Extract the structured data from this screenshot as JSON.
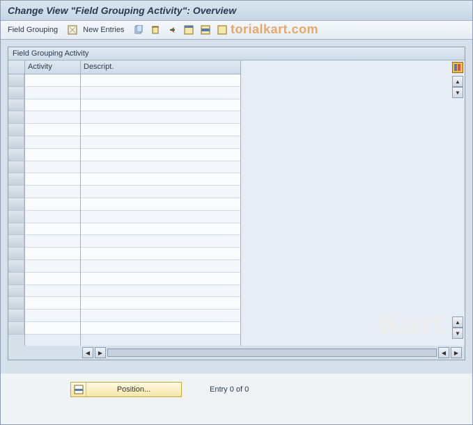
{
  "title": "Change View \"Field Grouping Activity\": Overview",
  "toolbar": {
    "field_grouping_label": "Field Grouping",
    "new_entries_label": "New Entries",
    "icons": {
      "details": "details-icon",
      "copy": "copy-icon",
      "delete": "delete-icon",
      "undo": "undo-icon",
      "select_all": "select-all-icon",
      "select_block": "select-block-icon",
      "deselect_all": "deselect-all-icon"
    }
  },
  "watermark": "torialkart.com",
  "big_watermark": "Kart",
  "panel": {
    "header": "Field Grouping Activity",
    "columns": {
      "activity": "Activity",
      "descript": "Descript."
    },
    "row_count": 21,
    "config_icon": "configure-columns-icon"
  },
  "footer": {
    "position_label": "Position...",
    "entry_text": "Entry 0 of 0"
  }
}
